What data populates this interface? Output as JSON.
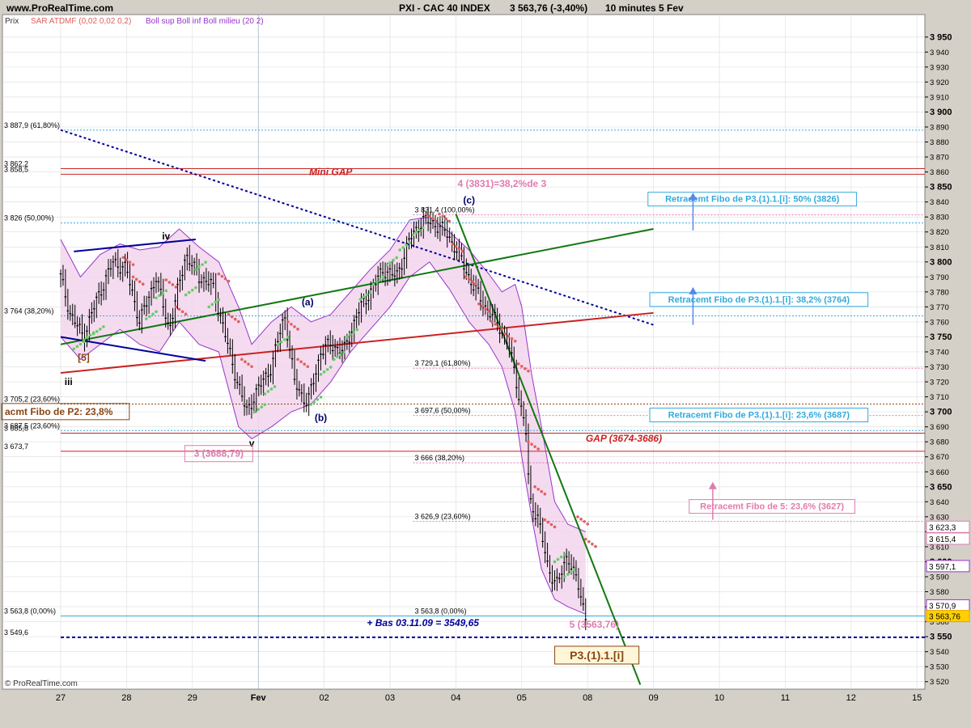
{
  "header": {
    "site": "www.ProRealTime.com",
    "title": "PXI - CAC 40 INDEX",
    "price_change": "3 563,76 (-3,40%)",
    "timeframe": "10 minutes  5 Fev"
  },
  "legend": {
    "price": "Prix",
    "sar": "SAR ATDMF (0,02 0,02 0,2)",
    "boll": "Boll sup Boll inf Boll milieu (20 2)"
  },
  "watermark": "© ProRealTime.com",
  "colors": {
    "plot_bg": "#ffffff",
    "frame_bg": "#d4d0c8",
    "grid": "#dcdcdc",
    "candle": "#000000",
    "sar_up": "#66cc66",
    "sar_down": "#e06060",
    "boll_line": "#9933cc",
    "boll_fill": "#f2d5ec",
    "channel": "#000099",
    "green_trend": "#117711",
    "red_trend": "#cc2222",
    "dotted_trend": "#000099",
    "fibo_blue": "#33aadd",
    "fibo_pink": "#e07bb0",
    "fibo_brown": "#8b4513",
    "gap_red": "#cc2222"
  },
  "chart_data": {
    "type": "candlestick",
    "title": "PXI - CAC 40 INDEX",
    "timeframe": "10 minutes",
    "x_labels": [
      "27",
      "28",
      "29",
      "Fev",
      "02",
      "03",
      "04",
      "05",
      "08",
      "09",
      "10",
      "11",
      "12",
      "15"
    ],
    "ylim": [
      3515,
      3965
    ],
    "y_ticks": [
      3520,
      3530,
      3540,
      3550,
      3560,
      3570,
      3580,
      3590,
      3600,
      3610,
      3620,
      3630,
      3640,
      3650,
      3660,
      3670,
      3680,
      3690,
      3700,
      3710,
      3720,
      3730,
      3740,
      3750,
      3760,
      3770,
      3780,
      3790,
      3800,
      3810,
      3820,
      3830,
      3840,
      3850,
      3860,
      3870,
      3880,
      3890,
      3900,
      3910,
      3920,
      3930,
      3940,
      3950
    ],
    "y_tick_labels": [
      "3 520",
      "3 530",
      "3 540",
      "3 550",
      "3 560",
      "3 570",
      "3 580",
      "3 590",
      "3 600",
      "3 610",
      "3 620",
      "3 630",
      "3 640",
      "3 650",
      "3 660",
      "3 670",
      "3 680",
      "3 690",
      "3 700",
      "3 710",
      "3 720",
      "3 730",
      "3 740",
      "3 750",
      "3 760",
      "3 770",
      "3 780",
      "3 790",
      "3 800",
      "3 810",
      "3 820",
      "3 830",
      "3 840",
      "3 850",
      "3 860",
      "3 870",
      "3 880",
      "3 890",
      "3 900",
      "3 910",
      "3 920",
      "3 930",
      "3 940",
      "3 950"
    ],
    "y_bold_ticks": [
      3550,
      3600,
      3650,
      3700,
      3750,
      3800,
      3850,
      3900,
      3950
    ],
    "price_path": [
      [
        0.0,
        3790
      ],
      [
        0.15,
        3765
      ],
      [
        0.35,
        3750
      ],
      [
        0.55,
        3775
      ],
      [
        0.8,
        3800
      ],
      [
        1.0,
        3795
      ],
      [
        1.2,
        3760
      ],
      [
        1.45,
        3790
      ],
      [
        1.65,
        3755
      ],
      [
        1.9,
        3805
      ],
      [
        2.1,
        3790
      ],
      [
        2.3,
        3785
      ],
      [
        2.45,
        3760
      ],
      [
        2.62,
        3730
      ],
      [
        2.82,
        3700
      ],
      [
        3.0,
        3715
      ],
      [
        3.2,
        3730
      ],
      [
        3.4,
        3765
      ],
      [
        3.55,
        3720
      ],
      [
        3.75,
        3705
      ],
      [
        3.95,
        3740
      ],
      [
        4.1,
        3745
      ],
      [
        4.3,
        3740
      ],
      [
        4.5,
        3765
      ],
      [
        4.7,
        3780
      ],
      [
        4.9,
        3795
      ],
      [
        5.1,
        3790
      ],
      [
        5.3,
        3815
      ],
      [
        5.5,
        3828
      ],
      [
        5.7,
        3825
      ],
      [
        5.85,
        3820
      ],
      [
        6.05,
        3805
      ],
      [
        6.25,
        3785
      ],
      [
        6.45,
        3770
      ],
      [
        6.65,
        3758
      ],
      [
        6.8,
        3745
      ],
      [
        6.92,
        3720
      ],
      [
        7.0,
        3700
      ],
      [
        7.06,
        3690
      ],
      [
        7.12,
        3640
      ],
      [
        7.25,
        3630
      ],
      [
        7.4,
        3595
      ],
      [
        7.55,
        3585
      ],
      [
        7.7,
        3605
      ],
      [
        7.85,
        3585
      ],
      [
        7.97,
        3563.8
      ]
    ],
    "sar_dots": [
      [
        0.2,
        3742,
        "up"
      ],
      [
        0.35,
        3748,
        "up"
      ],
      [
        0.5,
        3752,
        "up"
      ],
      [
        0.95,
        3803,
        "down"
      ],
      [
        1.1,
        3790,
        "down"
      ],
      [
        1.3,
        3762,
        "up"
      ],
      [
        1.45,
        3776,
        "up"
      ],
      [
        1.6,
        3788,
        "down"
      ],
      [
        1.75,
        3770,
        "down"
      ],
      [
        1.9,
        3778,
        "up"
      ],
      [
        2.05,
        3795,
        "up"
      ],
      [
        2.25,
        3770,
        "up"
      ],
      [
        2.4,
        3792,
        "down"
      ],
      [
        2.55,
        3765,
        "down"
      ],
      [
        2.75,
        3735,
        "down"
      ],
      [
        2.95,
        3700,
        "up"
      ],
      [
        3.1,
        3712,
        "up"
      ],
      [
        3.3,
        3745,
        "up"
      ],
      [
        3.45,
        3760,
        "down"
      ],
      [
        3.6,
        3735,
        "down"
      ],
      [
        3.8,
        3705,
        "up"
      ],
      [
        3.95,
        3725,
        "up"
      ],
      [
        4.15,
        3735,
        "up"
      ],
      [
        4.35,
        3750,
        "up"
      ],
      [
        4.55,
        3775,
        "up"
      ],
      [
        4.75,
        3785,
        "up"
      ],
      [
        4.95,
        3798,
        "up"
      ],
      [
        5.15,
        3808,
        "up"
      ],
      [
        5.35,
        3818,
        "up"
      ],
      [
        5.55,
        3832,
        "down"
      ],
      [
        5.75,
        3832,
        "down"
      ],
      [
        5.95,
        3812,
        "down"
      ],
      [
        6.15,
        3790,
        "down"
      ],
      [
        6.35,
        3772,
        "down"
      ],
      [
        6.55,
        3760,
        "down"
      ],
      [
        6.75,
        3752,
        "down"
      ],
      [
        6.95,
        3732,
        "down"
      ],
      [
        7.1,
        3680,
        "down"
      ],
      [
        7.2,
        3650,
        "down"
      ],
      [
        7.35,
        3628,
        "down"
      ],
      [
        7.5,
        3600,
        "up"
      ],
      [
        7.65,
        3590,
        "up"
      ],
      [
        7.85,
        3630,
        "down"
      ],
      [
        7.97,
        3615,
        "down"
      ]
    ],
    "bollinger": {
      "upper": [
        [
          0.0,
          3815
        ],
        [
          0.3,
          3790
        ],
        [
          0.6,
          3805
        ],
        [
          0.9,
          3812
        ],
        [
          1.2,
          3808
        ],
        [
          1.5,
          3810
        ],
        [
          1.8,
          3822
        ],
        [
          2.1,
          3810
        ],
        [
          2.4,
          3800
        ],
        [
          2.7,
          3770
        ],
        [
          2.9,
          3745
        ],
        [
          3.2,
          3760
        ],
        [
          3.5,
          3770
        ],
        [
          3.8,
          3760
        ],
        [
          4.1,
          3765
        ],
        [
          4.4,
          3780
        ],
        [
          4.7,
          3795
        ],
        [
          5.0,
          3808
        ],
        [
          5.3,
          3828
        ],
        [
          5.6,
          3830
        ],
        [
          5.9,
          3820
        ],
        [
          6.2,
          3808
        ],
        [
          6.5,
          3792
        ],
        [
          6.7,
          3780
        ],
        [
          6.9,
          3785
        ],
        [
          7.0,
          3770
        ],
        [
          7.15,
          3725
        ],
        [
          7.3,
          3690
        ],
        [
          7.5,
          3640
        ],
        [
          7.7,
          3625
        ],
        [
          7.97,
          3620
        ]
      ],
      "lower": [
        [
          0.0,
          3750
        ],
        [
          0.3,
          3735
        ],
        [
          0.6,
          3745
        ],
        [
          0.9,
          3755
        ],
        [
          1.2,
          3745
        ],
        [
          1.5,
          3740
        ],
        [
          1.8,
          3760
        ],
        [
          2.1,
          3745
        ],
        [
          2.4,
          3740
        ],
        [
          2.7,
          3690
        ],
        [
          2.9,
          3682
        ],
        [
          3.2,
          3690
        ],
        [
          3.5,
          3700
        ],
        [
          3.8,
          3705
        ],
        [
          4.1,
          3720
        ],
        [
          4.4,
          3740
        ],
        [
          4.7,
          3755
        ],
        [
          5.0,
          3770
        ],
        [
          5.3,
          3790
        ],
        [
          5.6,
          3800
        ],
        [
          5.9,
          3782
        ],
        [
          6.2,
          3760
        ],
        [
          6.5,
          3745
        ],
        [
          6.7,
          3730
        ],
        [
          6.9,
          3700
        ],
        [
          7.0,
          3670
        ],
        [
          7.15,
          3630
        ],
        [
          7.3,
          3595
        ],
        [
          7.5,
          3575
        ],
        [
          7.7,
          3570
        ],
        [
          7.97,
          3565
        ]
      ]
    },
    "trendlines": [
      {
        "name": "dotted-resistance",
        "from": [
          0.0,
          3888
        ],
        "to": [
          9.0,
          3758
        ],
        "style": "dotted"
      },
      {
        "name": "green-support",
        "from": [
          0.0,
          3745
        ],
        "to": [
          9.0,
          3822
        ],
        "style": "solid"
      },
      {
        "name": "red-line",
        "from": [
          0.0,
          3726
        ],
        "to": [
          9.0,
          3766
        ],
        "style": "solid"
      },
      {
        "name": "green-down",
        "from": [
          6.0,
          3832
        ],
        "to": [
          8.8,
          3518
        ],
        "style": "solid"
      },
      {
        "name": "channel-top",
        "from": [
          0.2,
          3807
        ],
        "to": [
          2.05,
          3815
        ],
        "style": "solid"
      },
      {
        "name": "channel-bottom",
        "from": [
          0.0,
          3750
        ],
        "to": [
          2.2,
          3734
        ],
        "style": "solid"
      }
    ],
    "horizontal_lines": [
      {
        "value": 3887.9,
        "label": "3 887,9 (61,80%)",
        "style": "dotted",
        "color": "fibo_blue",
        "from": 0.0
      },
      {
        "value": 3862.2,
        "label": "3 862,2",
        "style": "solid",
        "color": "gap_red",
        "from": 0.0
      },
      {
        "value": 3858.5,
        "label": "3 858,5",
        "style": "solid",
        "color": "gap_red",
        "from": 0.0
      },
      {
        "value": 3826.0,
        "label": "3 826 (50,00%)",
        "style": "dotted",
        "color": "fibo_blue",
        "from": 0.0
      },
      {
        "value": 3764.0,
        "label": "3 764 (38,20%)",
        "style": "dotted",
        "color": "fibo_blue",
        "from": 0.0
      },
      {
        "value": 3705.2,
        "label": "3 705,2 (23,60%)",
        "style": "dotted",
        "color": "fibo_brown",
        "from": 0.0
      },
      {
        "value": 3687.5,
        "label": "3 687,5 (23,60%)",
        "style": "dotted",
        "color": "fibo_blue",
        "from": 0.0
      },
      {
        "value": 3685.8,
        "label": "3 685,8",
        "style": "solid",
        "color": "gap_red",
        "from": 0.0
      },
      {
        "value": 3673.7,
        "label": "3 673,7",
        "style": "solid",
        "color": "gap_red",
        "from": 0.0
      },
      {
        "value": 3563.8,
        "label": "3 563,8 (0,00%)",
        "style": "solid",
        "color": "fibo_blue",
        "from": 0.0
      },
      {
        "value": 3549.6,
        "label": "3 549,6",
        "style": "dashed",
        "color": "dotted_trend",
        "from": 0.0
      },
      {
        "value": 3831.4,
        "label": "3 831,4 (100,00%)",
        "style": "dotted",
        "color": "fibo_pink",
        "from": 5.35
      },
      {
        "value": 3729.1,
        "label": "3 729,1 (61,80%)",
        "style": "dotted",
        "color": "fibo_pink",
        "from": 5.35
      },
      {
        "value": 3697.6,
        "label": "3 697,6 (50,00%)",
        "style": "dotted",
        "color": "fibo_pink",
        "from": 5.35
      },
      {
        "value": 3666.0,
        "label": "3 666 (38,20%)",
        "style": "dotted",
        "color": "fibo_pink",
        "from": 5.35
      },
      {
        "value": 3626.9,
        "label": "3 626,9 (23,60%)",
        "style": "dotted",
        "color": "fibo_pink",
        "from": 5.35
      },
      {
        "value": 3563.8,
        "label": "3 563,8 (0,00%)",
        "style": "none",
        "color": "fibo_pink",
        "from": 5.35
      }
    ],
    "wave_labels": [
      {
        "text": "iv",
        "x": 1.6,
        "y": 3815,
        "color": "#000000"
      },
      {
        "text": "iii",
        "x": 0.12,
        "y": 3718,
        "color": "#000000"
      },
      {
        "text": "v",
        "x": 2.9,
        "y": 3677,
        "color": "#000000"
      },
      {
        "text": "(a)",
        "x": 3.75,
        "y": 3771,
        "color": "#000066"
      },
      {
        "text": "(b)",
        "x": 3.95,
        "y": 3694,
        "color": "#000066"
      },
      {
        "text": "(c)",
        "x": 6.2,
        "y": 3839,
        "color": "#000066"
      },
      {
        "text": "[5]",
        "x": 0.35,
        "y": 3734,
        "color": "#8b4513"
      }
    ],
    "annotations": [
      {
        "text": "Mini GAP",
        "x": 4.1,
        "y": 3858,
        "color": "#cc2222",
        "italic": true
      },
      {
        "text": "4 (3831)=38,2%de 3",
        "x": 6.7,
        "y": 3850,
        "color": "#e07bb0"
      },
      {
        "text": "3 (3688,79)",
        "x": 2.4,
        "y": 3670,
        "color": "#e07bb0",
        "boxed": true
      },
      {
        "text": "GAP (3674-3686)",
        "x": 8.55,
        "y": 3680,
        "color": "#cc2222",
        "italic": true
      },
      {
        "text": "5 (3563,76)",
        "x": 8.1,
        "y": 3556,
        "color": "#e07bb0"
      },
      {
        "text": "+ Bas 03.11.09 = 3549,65",
        "x": 5.5,
        "y": 3557,
        "color": "#000099",
        "italic": true
      },
      {
        "text": "P3.(1).1.[i]",
        "x": 8.14,
        "y": 3535,
        "color": "#8b4513",
        "boxed": true,
        "big": true
      },
      {
        "text": "acmt Fibo de P2: 23,8%",
        "x": 0.0,
        "y": 3698,
        "color": "#8b4513",
        "boxed": true
      }
    ],
    "fibo_boxes": [
      {
        "text": "Retracemt Fibo de P3.(1).1.[i]: 50% (3826)",
        "x": 10.5,
        "y": 3840,
        "color": "#33aadd"
      },
      {
        "text": "Retracemt Fibo de P3.(1).1.[i]: 38,2% (3764)",
        "x": 10.6,
        "y": 3773,
        "color": "#33aadd"
      },
      {
        "text": "Retracemt Fibo de P3.(1).1.[i]: 23,6% (3687)",
        "x": 10.6,
        "y": 3696,
        "color": "#33aadd"
      },
      {
        "text": "Retracemt Fibo de 5: 23,6% (3627)",
        "x": 10.8,
        "y": 3635,
        "color": "#e07bb0"
      }
    ],
    "arrows": [
      {
        "x": 9.6,
        "from": 3821,
        "to": 3843,
        "color": "#5588ee"
      },
      {
        "x": 9.6,
        "from": 3758,
        "to": 3780,
        "color": "#5588ee"
      },
      {
        "x": 9.9,
        "from": 3628,
        "to": 3650,
        "color": "#e07bb0"
      }
    ],
    "price_tags": [
      {
        "value": 3623.3,
        "text": "3 623,3",
        "color": "#e07bb0"
      },
      {
        "value": 3615.4,
        "text": "3 615,4",
        "color": "#e07bb0"
      },
      {
        "value": 3597.1,
        "text": "3 597,1",
        "color": "#9933cc"
      },
      {
        "value": 3570.9,
        "text": "3 570,9",
        "color": "#9933cc"
      },
      {
        "value": 3563.76,
        "text": "3 563,76",
        "color": "#e8a000"
      }
    ]
  }
}
